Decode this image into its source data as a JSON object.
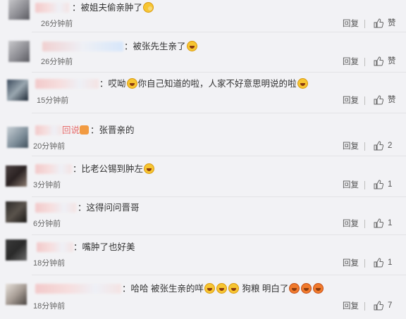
{
  "actions": {
    "reply_label": "回复",
    "like_label": "赞"
  },
  "comments": [
    {
      "segments": [
        "：被姐夫偷亲肿了"
      ],
      "time": "26分钟前",
      "likes": "赞"
    },
    {
      "segments": [
        "：被张先生亲了"
      ],
      "time": "26分钟前",
      "likes": "赞"
    },
    {
      "segments": [
        "：哎呦",
        "你自己知道的啦，人家不好意思明说的啦"
      ],
      "time": "15分钟前",
      "likes": "赞"
    },
    {
      "name_tail": "回说",
      "segments": [
        "：张晋亲的"
      ],
      "time": "20分钟前",
      "likes": "2"
    },
    {
      "segments": [
        "：比老公锡到肿左"
      ],
      "time": "3分钟前",
      "likes": "1"
    },
    {
      "segments": [
        "：这得问问晋哥"
      ],
      "time": "6分钟前",
      "likes": "1"
    },
    {
      "segments": [
        "：嘴肿了也好美"
      ],
      "time": "18分钟前",
      "likes": "1"
    },
    {
      "segments": [
        "：哈哈 被张生亲的咩",
        " 狗粮 明白了"
      ],
      "time": "18分钟前",
      "likes": "7"
    }
  ]
}
